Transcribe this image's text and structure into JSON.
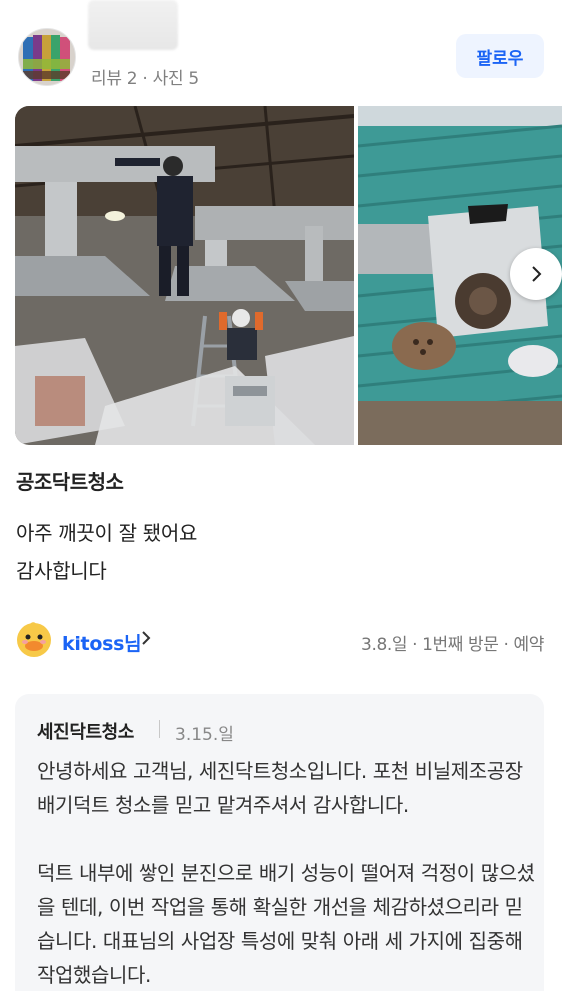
{
  "profile": {
    "meta": "리뷰 2 · 사진 5",
    "follow_label": "팔로우"
  },
  "gallery": {
    "photos": [
      "duct-cleaning-indoor-photo",
      "duct-cleaning-roof-photo"
    ],
    "next_icon": "chevron-right-icon"
  },
  "review": {
    "title": "공조닥트청소",
    "body": [
      "아주 깨끗이 잘 됐어요",
      "감사합니다"
    ]
  },
  "reviewer": {
    "name": "kitoss",
    "name_suffix": "님",
    "meta": "3.8.일 · 1번째 방문 · 예약",
    "avatar_icon": "duck-emoji-icon"
  },
  "reply": {
    "business_name": "세진닥트청소",
    "date": "3.15.일",
    "text": "안녕하세요 고객님, 세진닥트청소입니다. 포천 비닐제조공장 배기덕트 청소를 믿고 맡겨주셔서 감사합니다.\n\n덕트 내부에 쌓인 분진으로 배기 성능이 떨어져 걱정이 많으셨을 텐데, 이번 작업을 통해 확실한 개선을 체감하셨으리라 믿습니다. 대표님의 사업장 특성에 맞춰 아래 세 가지에 집중해 작업했습니다."
  },
  "colors": {
    "accent": "#1b64f5",
    "follow_bg": "#eef4ff",
    "reply_bg": "#f5f6f8"
  }
}
